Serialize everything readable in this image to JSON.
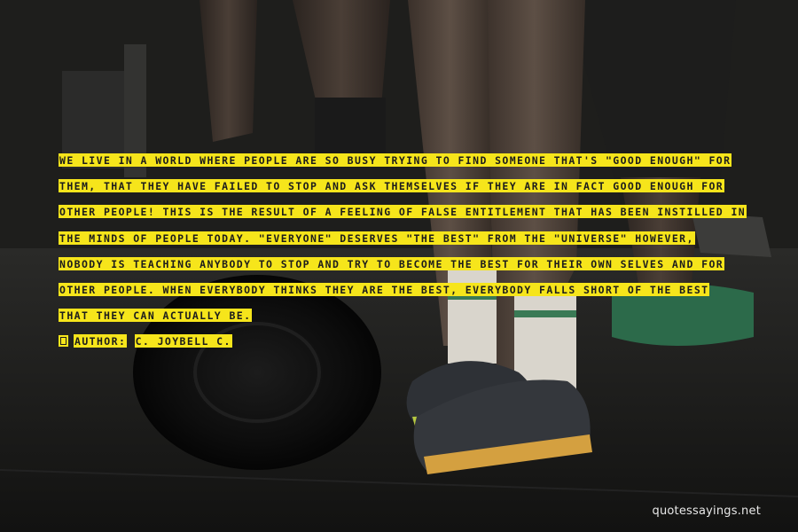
{
  "quote": {
    "lines": [
      "WE LIVE IN A WORLD WHERE PEOPLE ARE SO BUSY TRYING TO FIND SOMEONE THAT'S \"GOOD ENOUGH\" FOR",
      "THEM, THAT THEY HAVE FAILED TO STOP AND ASK THEMSELVES IF THEY ARE IN FACT GOOD ENOUGH FOR",
      "OTHER PEOPLE! THIS IS THE RESULT OF A FEELING OF FALSE ENTITLEMENT THAT HAS BEEN INSTILLED IN",
      "THE MINDS OF PEOPLE TODAY. \"EVERYONE\" DESERVES \"THE BEST\" FROM THE \"UNIVERSE\" HOWEVER,",
      "NOBODY IS TEACHING ANYBODY TO STOP AND TRY TO BECOME THE BEST FOR THEIR OWN SELVES AND FOR",
      "OTHER PEOPLE. WHEN EVERYBODY THINKS THEY ARE THE BEST, EVERYBODY FALLS SHORT OF THE BEST",
      "THAT THEY CAN ACTUALLY BE."
    ],
    "author_label": "AUTHOR:",
    "author_name": "C. JOYBELL C.",
    "highlight_color": "#f6e51b",
    "text_color": "#1c1c1c"
  },
  "watermark": "quotessayings.net",
  "background": {
    "description_icons": [
      "barbell-plate-icon",
      "sneaker-icon"
    ]
  }
}
